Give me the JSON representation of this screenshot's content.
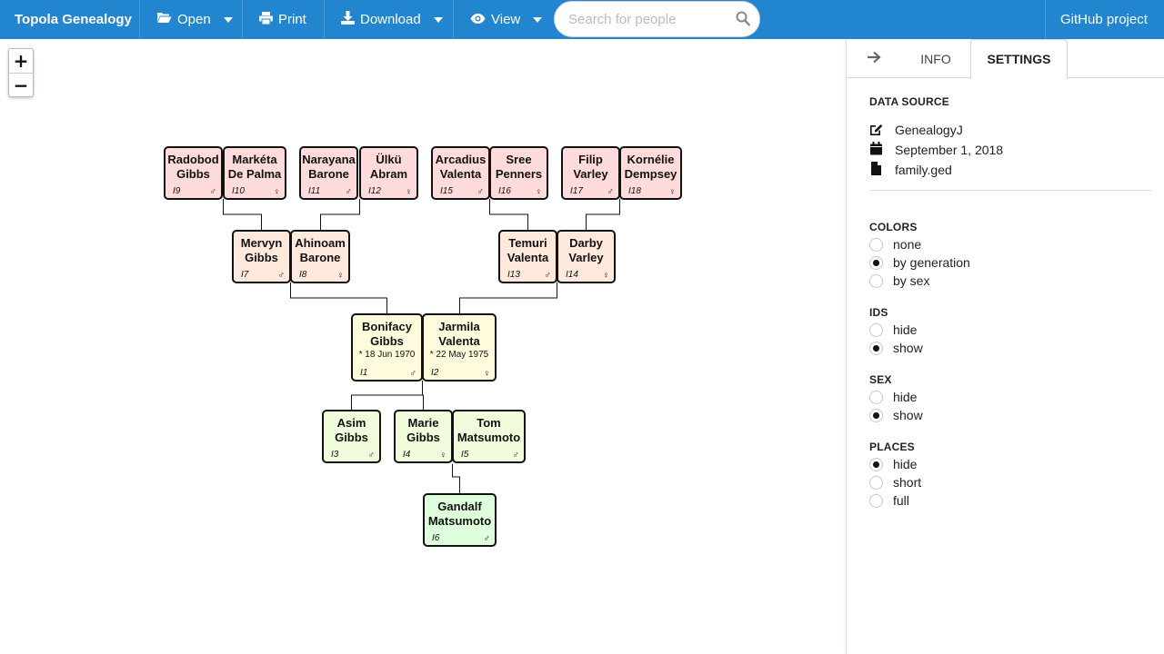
{
  "topbar": {
    "brand": "Topola Genealogy",
    "open_label": "Open",
    "print_label": "Print",
    "download_label": "Download",
    "view_label": "View",
    "search_placeholder": "Search for people",
    "github_label": "GitHub project"
  },
  "zoom": {
    "in_label": "+",
    "out_label": "−"
  },
  "people": {
    "p9": {
      "name1": "Radobod",
      "name2": "Gibbs",
      "id": "I9",
      "sex": "♂"
    },
    "p10": {
      "name1": "Markéta",
      "name2": "De Palma",
      "id": "I10",
      "sex": "♀"
    },
    "p11": {
      "name1": "Narayana",
      "name2": "Barone",
      "id": "I11",
      "sex": "♂"
    },
    "p12": {
      "name1": "Ülkü",
      "name2": "Abram",
      "id": "I12",
      "sex": "♀"
    },
    "p15": {
      "name1": "Arcadius",
      "name2": "Valenta",
      "id": "I15",
      "sex": "♂"
    },
    "p16": {
      "name1": "Sree",
      "name2": "Penners",
      "id": "I16",
      "sex": "♀"
    },
    "p17": {
      "name1": "Filip",
      "name2": "Varley",
      "id": "I17",
      "sex": "♂"
    },
    "p18": {
      "name1": "Kornélie",
      "name2": "Dempsey",
      "id": "I18",
      "sex": "♀"
    },
    "p7": {
      "name1": "Mervyn",
      "name2": "Gibbs",
      "id": "I7",
      "sex": "♂"
    },
    "p8": {
      "name1": "Ahinoam",
      "name2": "Barone",
      "id": "I8",
      "sex": "♀"
    },
    "p13": {
      "name1": "Temuri",
      "name2": "Valenta",
      "id": "I13",
      "sex": "♂"
    },
    "p14": {
      "name1": "Darby",
      "name2": "Varley",
      "id": "I14",
      "sex": "♀"
    },
    "p1": {
      "name1": "Bonifacy",
      "name2": "Gibbs",
      "birth": "* 18 Jun 1970",
      "id": "I1",
      "sex": "♂"
    },
    "p2": {
      "name1": "Jarmila",
      "name2": "Valenta",
      "birth": "* 22 May 1975",
      "id": "I2",
      "sex": "♀"
    },
    "p3": {
      "name1": "Asim",
      "name2": "Gibbs",
      "id": "I3",
      "sex": "♂"
    },
    "p4": {
      "name1": "Marie",
      "name2": "Gibbs",
      "id": "I4",
      "sex": "♀"
    },
    "p5": {
      "name1": "Tom",
      "name2": "Matsumoto",
      "id": "I5",
      "sex": "♂"
    },
    "p6": {
      "name1": "Gandalf",
      "name2": "Matsumoto",
      "id": "I6",
      "sex": "♂"
    }
  },
  "panel": {
    "tabs": {
      "info": "INFO",
      "settings": "SETTINGS"
    },
    "data_source": {
      "heading": "DATA SOURCE",
      "author": "GenealogyJ",
      "date": "September 1, 2018",
      "file": "family.ged"
    },
    "colors": {
      "heading": "COLORS",
      "options": [
        "none",
        "by generation",
        "by sex"
      ],
      "selected": "by generation"
    },
    "ids": {
      "heading": "IDS",
      "options": [
        "hide",
        "show"
      ],
      "selected": "show"
    },
    "sex": {
      "heading": "SEX",
      "options": [
        "hide",
        "show"
      ],
      "selected": "show"
    },
    "places": {
      "heading": "PLACES",
      "options": [
        "hide",
        "short",
        "full"
      ],
      "selected": "hide"
    }
  }
}
